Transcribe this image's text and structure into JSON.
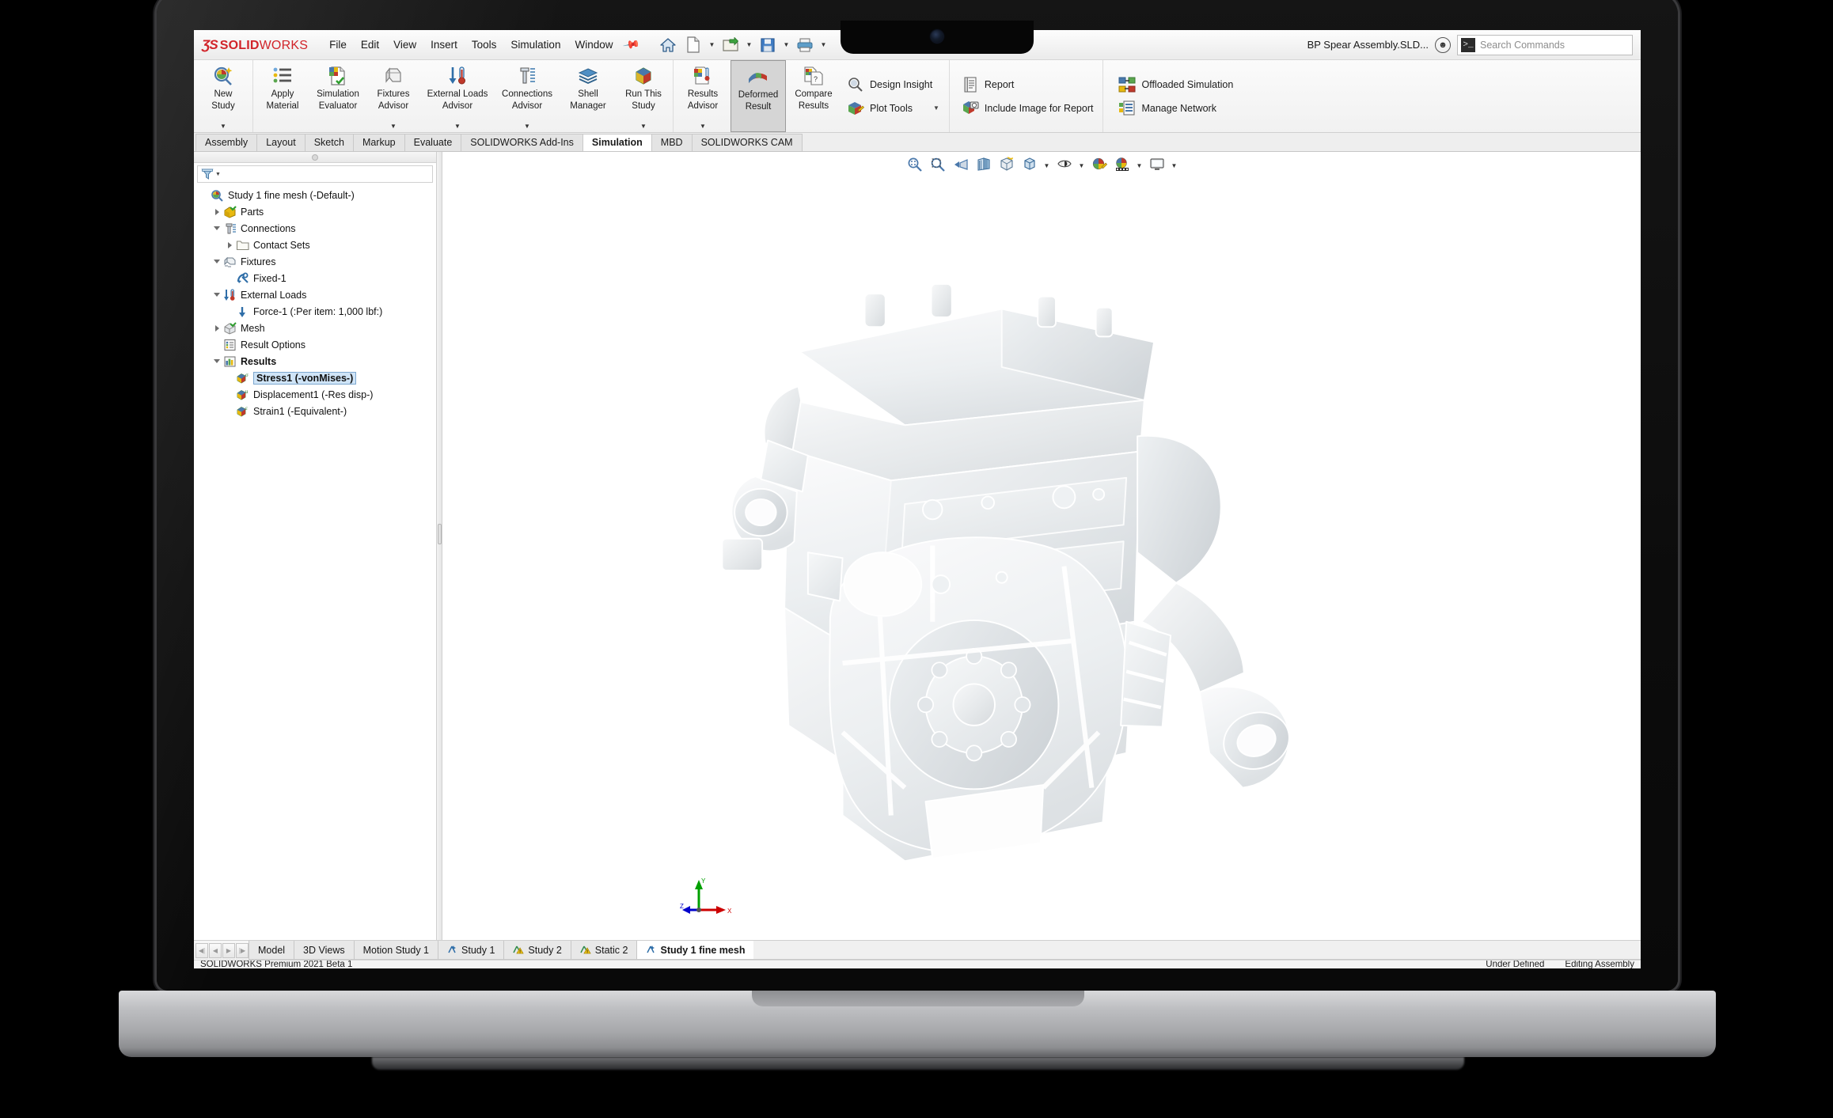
{
  "app": {
    "brand_ds": "ƷS",
    "brand_solid": "SOLID",
    "brand_works": "WORKS",
    "document_title": "BP Spear Assembly.SLD...",
    "accent_color": "#d1242a",
    "selection_color": "#cfe4f7"
  },
  "menu": {
    "items": [
      "File",
      "Edit",
      "View",
      "Insert",
      "Tools",
      "Simulation",
      "Window"
    ],
    "pin_icon": "pushpin-icon"
  },
  "quick_access": {
    "buttons": [
      {
        "name": "home-button",
        "icon": "home-icon",
        "caret": false
      },
      {
        "name": "new-document-button",
        "icon": "new-document-icon",
        "caret": true
      },
      {
        "name": "open-document-button",
        "icon": "open-folder-icon",
        "caret": true
      },
      {
        "name": "save-button",
        "icon": "floppy-disk-icon",
        "caret": true
      },
      {
        "name": "print-button",
        "icon": "printer-icon",
        "caret": true
      }
    ]
  },
  "search": {
    "placeholder": "Search Commands",
    "icon": "search-prompt-icon"
  },
  "help": {
    "icon": "smiley-face-icon"
  },
  "ribbon": {
    "big_buttons": [
      {
        "name": "new-study-button",
        "line1": "New",
        "line2": "Study",
        "icon": "new-study-icon",
        "caret": true,
        "selected": false
      },
      {
        "name": "apply-material-button",
        "line1": "Apply",
        "line2": "Material",
        "icon": "apply-material-icon",
        "caret": false,
        "selected": false
      },
      {
        "name": "simulation-evaluator-button",
        "line1": "Simulation",
        "line2": "Evaluator",
        "icon": "simulation-evaluator-icon",
        "caret": false,
        "selected": false
      },
      {
        "name": "fixtures-advisor-button",
        "line1": "Fixtures",
        "line2": "Advisor",
        "icon": "fixtures-advisor-icon",
        "caret": true,
        "selected": false
      },
      {
        "name": "external-loads-advisor-button",
        "line1": "External Loads",
        "line2": "Advisor",
        "icon": "external-loads-icon",
        "caret": true,
        "selected": false
      },
      {
        "name": "connections-advisor-button",
        "line1": "Connections",
        "line2": "Advisor",
        "icon": "connections-advisor-icon",
        "caret": true,
        "selected": false
      },
      {
        "name": "shell-manager-button",
        "line1": "Shell",
        "line2": "Manager",
        "icon": "shell-manager-icon",
        "caret": false,
        "selected": false
      },
      {
        "name": "run-this-study-button",
        "line1": "Run This",
        "line2": "Study",
        "icon": "run-study-icon",
        "caret": true,
        "selected": false
      },
      {
        "name": "results-advisor-button",
        "line1": "Results",
        "line2": "Advisor",
        "icon": "results-advisor-icon",
        "caret": true,
        "selected": false
      },
      {
        "name": "deformed-result-button",
        "line1": "Deformed",
        "line2": "Result",
        "icon": "deformed-result-icon",
        "caret": false,
        "selected": true
      },
      {
        "name": "compare-results-button",
        "line1": "Compare",
        "line2": "Results",
        "icon": "compare-results-icon",
        "caret": false,
        "selected": false
      }
    ],
    "group_design": [
      {
        "name": "design-insight-button",
        "label": "Design Insight",
        "icon": "design-insight-icon",
        "caret": false
      },
      {
        "name": "plot-tools-button",
        "label": "Plot Tools",
        "icon": "plot-tools-icon",
        "caret": true
      }
    ],
    "group_report": [
      {
        "name": "report-button",
        "label": "Report",
        "icon": "report-icon",
        "caret": false
      },
      {
        "name": "include-image-for-report-button",
        "label": "Include Image for Report",
        "icon": "camera-image-icon",
        "caret": false
      }
    ],
    "group_network": [
      {
        "name": "offloaded-simulation-button",
        "label": "Offloaded Simulation",
        "icon": "offloaded-simulation-icon",
        "caret": false
      },
      {
        "name": "manage-network-button",
        "label": "Manage Network",
        "icon": "manage-network-icon",
        "caret": false
      }
    ]
  },
  "command_tabs": {
    "items": [
      {
        "label": "Assembly",
        "active": false
      },
      {
        "label": "Layout",
        "active": false
      },
      {
        "label": "Sketch",
        "active": false
      },
      {
        "label": "Markup",
        "active": false
      },
      {
        "label": "Evaluate",
        "active": false
      },
      {
        "label": "SOLIDWORKS Add-Ins",
        "active": false
      },
      {
        "label": "Simulation",
        "active": true
      },
      {
        "label": "MBD",
        "active": false
      },
      {
        "label": "SOLIDWORKS CAM",
        "active": false
      }
    ]
  },
  "filter_bar": {
    "icon": "filter-funnel-icon",
    "value": ""
  },
  "tree": {
    "nodes": [
      {
        "label": "Study 1 fine mesh (-Default-)",
        "indent": 0,
        "toggle": "none",
        "icon": "study-icon",
        "selected": false,
        "bold": false,
        "name": "tree-item-study"
      },
      {
        "label": "Parts",
        "indent": 1,
        "toggle": "right",
        "icon": "parts-icon",
        "selected": false,
        "bold": false,
        "name": "tree-item-parts"
      },
      {
        "label": "Connections",
        "indent": 1,
        "toggle": "down",
        "icon": "connections-icon",
        "selected": false,
        "bold": false,
        "name": "tree-item-connections"
      },
      {
        "label": "Contact Sets",
        "indent": 2,
        "toggle": "right",
        "icon": "folder-icon",
        "selected": false,
        "bold": false,
        "name": "tree-item-contact-sets"
      },
      {
        "label": "Fixtures",
        "indent": 1,
        "toggle": "down",
        "icon": "fixtures-icon",
        "selected": false,
        "bold": false,
        "name": "tree-item-fixtures"
      },
      {
        "label": "Fixed-1",
        "indent": 2,
        "toggle": "none",
        "icon": "anchor-icon",
        "selected": false,
        "bold": false,
        "name": "tree-item-fixed-1"
      },
      {
        "label": "External Loads",
        "indent": 1,
        "toggle": "down",
        "icon": "external-loads-tree-icon",
        "selected": false,
        "bold": false,
        "name": "tree-item-external-loads"
      },
      {
        "label": "Force-1 (:Per item: 1,000 lbf:)",
        "indent": 2,
        "toggle": "none",
        "icon": "force-arrow-icon",
        "selected": false,
        "bold": false,
        "name": "tree-item-force-1"
      },
      {
        "label": "Mesh",
        "indent": 1,
        "toggle": "right",
        "icon": "mesh-icon",
        "selected": false,
        "bold": false,
        "name": "tree-item-mesh"
      },
      {
        "label": "Result Options",
        "indent": 1,
        "toggle": "none",
        "icon": "result-options-icon",
        "selected": false,
        "bold": false,
        "name": "tree-item-result-options"
      },
      {
        "label": "Results",
        "indent": 1,
        "toggle": "down",
        "icon": "results-folder-icon",
        "selected": false,
        "bold": true,
        "name": "tree-item-results"
      },
      {
        "label": "Stress1 (-vonMises-)",
        "indent": 2,
        "toggle": "none",
        "icon": "plot-stress-icon",
        "selected": true,
        "bold": true,
        "name": "tree-item-stress1"
      },
      {
        "label": "Displacement1 (-Res disp-)",
        "indent": 2,
        "toggle": "none",
        "icon": "plot-displacement-icon",
        "selected": false,
        "bold": false,
        "name": "tree-item-displacement1"
      },
      {
        "label": "Strain1 (-Equivalent-)",
        "indent": 2,
        "toggle": "none",
        "icon": "plot-strain-icon",
        "selected": false,
        "bold": false,
        "name": "tree-item-strain1"
      }
    ]
  },
  "view_toolbar": {
    "buttons": [
      {
        "name": "zoom-to-fit-button",
        "icon": "zoom-to-fit-icon",
        "caret": false
      },
      {
        "name": "zoom-to-area-button",
        "icon": "zoom-to-area-icon",
        "caret": false
      },
      {
        "name": "previous-view-button",
        "icon": "previous-view-icon",
        "caret": false
      },
      {
        "name": "section-view-button",
        "icon": "section-view-icon",
        "caret": false
      },
      {
        "name": "view-orientation-button",
        "icon": "view-orientation-icon",
        "caret": false
      },
      {
        "name": "display-style-button",
        "icon": "display-style-icon",
        "caret": true
      },
      {
        "name": "hide-show-items-button",
        "icon": "hide-show-items-icon",
        "caret": true
      },
      {
        "name": "edit-appearance-button",
        "icon": "edit-appearance-icon",
        "caret": false
      },
      {
        "name": "apply-scene-button",
        "icon": "apply-scene-icon",
        "caret": true
      },
      {
        "name": "view-settings-button",
        "icon": "view-settings-icon",
        "caret": true
      }
    ]
  },
  "triad": {
    "x_label": "X",
    "y_label": "Y",
    "z_label": "Z",
    "x_color": "#cc0000",
    "y_color": "#00a000",
    "z_color": "#0000cc"
  },
  "viewport": {
    "model_name": "engine-assembly-model",
    "background_color": "#ffffff",
    "model_base_color": "#e9ecee"
  },
  "document_tabs": {
    "nav": [
      "first-page-icon",
      "previous-page-icon",
      "next-page-icon",
      "last-page-icon"
    ],
    "items": [
      {
        "label": "Model",
        "icon": "",
        "active": false,
        "name": "doc-tab-model"
      },
      {
        "label": "3D Views",
        "icon": "",
        "active": false,
        "name": "doc-tab-3d-views"
      },
      {
        "label": "Motion Study 1",
        "icon": "",
        "active": false,
        "name": "doc-tab-motion-study-1"
      },
      {
        "label": "Study 1",
        "icon": "study-tab-icon",
        "active": false,
        "name": "doc-tab-study-1"
      },
      {
        "label": "Study 2",
        "icon": "study-warn-icon",
        "active": false,
        "name": "doc-tab-study-2"
      },
      {
        "label": "Static 2",
        "icon": "study-warn-icon",
        "active": false,
        "name": "doc-tab-static-2"
      },
      {
        "label": "Study 1 fine mesh",
        "icon": "study-tab-icon",
        "active": true,
        "name": "doc-tab-study-1-fine-mesh"
      }
    ]
  },
  "status_bar": {
    "left": "SOLIDWORKS Premium 2021 Beta 1",
    "right": [
      "Under Defined",
      "Editing Assembly"
    ]
  }
}
